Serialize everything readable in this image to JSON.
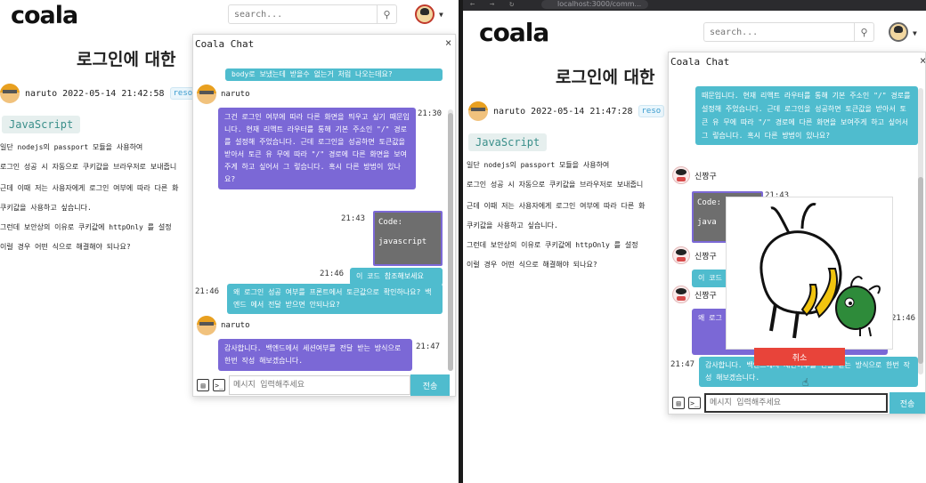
{
  "brand": {
    "logo": "coala"
  },
  "search": {
    "placeholder": "search..."
  },
  "post": {
    "title": "로그인에 대한",
    "tag_label": "JavaScript",
    "author": "naruto",
    "left_date": "2022-05-14 21:42:58",
    "right_date": "2022-05-14 21:47:28",
    "badge": "reso",
    "body": [
      "일단 nodejs의 passport 모듈을 사용하여",
      "로그인 성공 시 자동으로 쿠키값을 브라우저로 보내줍니",
      "근데 이때 저는 사용자에게 로그인 여부에 따라 다른 화",
      "쿠키값을 사용하고 싶습니다.",
      "그런데 보안상의 이유로 쿠키값에 httpOnly 를 설정",
      "이럴 경우 어떤 식으로 해결해야 되나요?"
    ]
  },
  "chat": {
    "title": "Coala Chat",
    "close": "×",
    "input_placeholder": "메시지 입력해주세요",
    "send_label": "전송",
    "cancel_label": "취소",
    "left": {
      "top_snippet": "body로 보냈는데 받을수 없는거 처럼 나오는데요?",
      "sender1": "naruto",
      "msg1": "그건 로그인 여부에 따라 다른 화면을 띄우고 싶기 때문입니다. 현재 리액트 라우터를 통해 기본 주소인 \"/\" 경로를 설정해 주었습니다. 근데 로그인을 성공하면 토큰값을 받아서 토큰 유 무에 따라 \"/\" 경로에 다른 화면을 보여주게 하고 싶어서 그 렇습니다. 혹시 다른 방법이 있나요?",
      "time1": "21:30",
      "code_label": "Code:",
      "code_lang": "javascript",
      "time2": "21:43",
      "msg3": "이 코드 참조해보세요",
      "time3": "21:46",
      "msg4": "왜 로그인 성공 여부를 프론트에서 토큰값으로 확인하나요? 백엔드 에서 전달 받으면 안되나요?",
      "time4": "21:46",
      "sender2": "naruto",
      "msg5": "감사합니다. 백엔드에서 세션여부를 전달 받는 방식으로 한번 작성 해보겠습니다.",
      "time5": "21:47"
    },
    "right": {
      "msg_top": "때문입니다. 현재 리액트 라우터를 통해 기본 주소인 \"/\" 경로를 설정해 주었습니다. 근데 로그인을 성공하면 토큰값을 받아서 토큰 유 무에 따라 \"/\" 경로에 다른 화면을 보여주게 하고 싶어서 그 렇습니다. 혹시 다른 방법이 있나요?",
      "sender_a": "신짱구",
      "code_label": "Code:",
      "code_lang": "java",
      "time_a": "21:43",
      "sender_b": "신짱구",
      "msg_b": "이 코드",
      "sender_c": "신짱구",
      "msg_c": "왜 로그 확인하 요?",
      "time_c": "21:46",
      "msg_last": "감사합니다. 백엔드에서 세션여부를 전달 받는 방식으로 한번 작성 해보겠습니다.",
      "time_last": "21:47"
    }
  },
  "browser": {
    "url": "localhost:3000/comm..."
  }
}
